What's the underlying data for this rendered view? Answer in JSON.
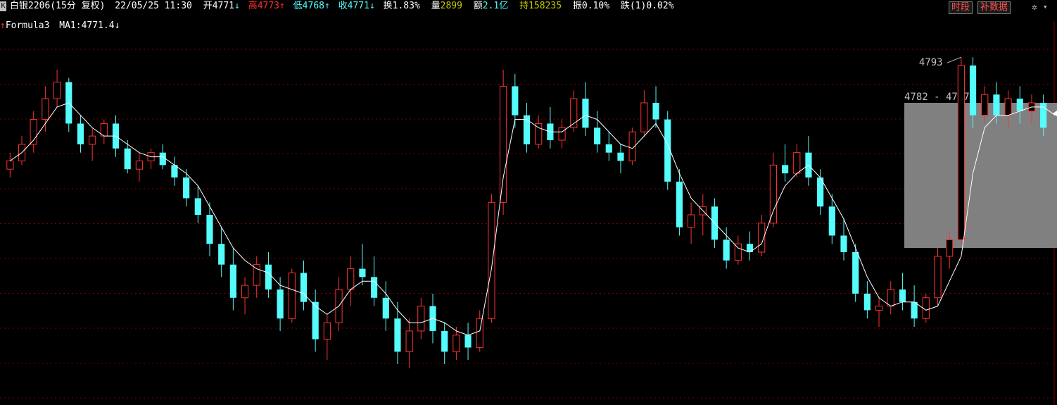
{
  "header": {
    "symbol": "白银2206(15分 复权)",
    "datetime": "22/05/25 11:30",
    "open_label": "开",
    "open": "4771",
    "open_arrow": "↓",
    "high_label": "高",
    "high": "4773",
    "high_arrow": "↑",
    "low_label": "低",
    "low": "4768",
    "low_arrow": "↑",
    "close_label": "收",
    "close": "4771",
    "close_arrow": "↓",
    "turnover_label": "换",
    "turnover": "1.83%",
    "volume_label": "量",
    "volume": "2899",
    "amount_label": "额",
    "amount": "2.1亿",
    "hold_label": "持",
    "hold": "158235",
    "amplitude_label": "振",
    "amplitude": "0.10%",
    "change_label": "跌",
    "change": "(1)0.02%",
    "btn_time": "时段",
    "btn_fill": "补数据",
    "corner": "K"
  },
  "indicator": {
    "name": "Formula3",
    "ma_label": "MA1:",
    "ma_value": "4771.4",
    "ma_arrow": "↓"
  },
  "colors": {
    "up": "#ff3232",
    "down": "#54fcfc",
    "ma": "#ffffff",
    "grid": "#800000",
    "zone": "#808080",
    "bg": "#000000"
  },
  "chart_data": {
    "type": "candlestick",
    "ylim": [
      4710,
      4800
    ],
    "annotations": {
      "high_label": "4793",
      "zone_label": "4782 - 4747",
      "zone_range": [
        4747,
        4782
      ]
    },
    "series": [
      {
        "name": "price",
        "candles_ohlc": [
          [
            4766,
            4770,
            4764,
            4768
          ],
          [
            4768,
            4774,
            4767,
            4772
          ],
          [
            4772,
            4780,
            4770,
            4778
          ],
          [
            4778,
            4786,
            4775,
            4783
          ],
          [
            4783,
            4790,
            4781,
            4787
          ],
          [
            4787,
            4788,
            4775,
            4777
          ],
          [
            4777,
            4779,
            4770,
            4772
          ],
          [
            4772,
            4776,
            4768,
            4774
          ],
          [
            4774,
            4778,
            4772,
            4777
          ],
          [
            4777,
            4779,
            4769,
            4771
          ],
          [
            4771,
            4773,
            4765,
            4766
          ],
          [
            4766,
            4770,
            4763,
            4768
          ],
          [
            4768,
            4771,
            4766,
            4770
          ],
          [
            4770,
            4772,
            4766,
            4767
          ],
          [
            4767,
            4769,
            4762,
            4764
          ],
          [
            4764,
            4766,
            4757,
            4759
          ],
          [
            4759,
            4762,
            4753,
            4755
          ],
          [
            4755,
            4758,
            4745,
            4748
          ],
          [
            4748,
            4752,
            4740,
            4743
          ],
          [
            4743,
            4747,
            4732,
            4735
          ],
          [
            4735,
            4740,
            4731,
            4738
          ],
          [
            4738,
            4745,
            4735,
            4743
          ],
          [
            4743,
            4746,
            4735,
            4737
          ],
          [
            4737,
            4740,
            4727,
            4730
          ],
          [
            4730,
            4742,
            4729,
            4741
          ],
          [
            4741,
            4744,
            4732,
            4734
          ],
          [
            4734,
            4737,
            4722,
            4725
          ],
          [
            4725,
            4731,
            4720,
            4729
          ],
          [
            4729,
            4740,
            4727,
            4737
          ],
          [
            4737,
            4745,
            4733,
            4742
          ],
          [
            4742,
            4748,
            4738,
            4740
          ],
          [
            4740,
            4745,
            4733,
            4735
          ],
          [
            4735,
            4739,
            4727,
            4730
          ],
          [
            4730,
            4734,
            4719,
            4722
          ],
          [
            4722,
            4730,
            4718,
            4727
          ],
          [
            4727,
            4735,
            4725,
            4733
          ],
          [
            4733,
            4736,
            4724,
            4727
          ],
          [
            4727,
            4729,
            4719,
            4722
          ],
          [
            4722,
            4728,
            4720,
            4726
          ],
          [
            4726,
            4729,
            4720,
            4723
          ],
          [
            4723,
            4732,
            4722,
            4730
          ],
          [
            4730,
            4760,
            4729,
            4758
          ],
          [
            4758,
            4790,
            4755,
            4786
          ],
          [
            4786,
            4789,
            4776,
            4779
          ],
          [
            4779,
            4782,
            4770,
            4772
          ],
          [
            4772,
            4779,
            4771,
            4777
          ],
          [
            4777,
            4781,
            4771,
            4773
          ],
          [
            4773,
            4778,
            4771,
            4776
          ],
          [
            4776,
            4785,
            4775,
            4783
          ],
          [
            4783,
            4787,
            4774,
            4776
          ],
          [
            4776,
            4780,
            4770,
            4772
          ],
          [
            4772,
            4775,
            4768,
            4770
          ],
          [
            4770,
            4772,
            4765,
            4768
          ],
          [
            4768,
            4776,
            4767,
            4775
          ],
          [
            4775,
            4785,
            4774,
            4782
          ],
          [
            4782,
            4786,
            4776,
            4778
          ],
          [
            4778,
            4780,
            4761,
            4763
          ],
          [
            4763,
            4766,
            4750,
            4752
          ],
          [
            4752,
            4758,
            4748,
            4755
          ],
          [
            4755,
            4760,
            4750,
            4757
          ],
          [
            4757,
            4759,
            4747,
            4749
          ],
          [
            4749,
            4752,
            4742,
            4744
          ],
          [
            4744,
            4750,
            4743,
            4748
          ],
          [
            4748,
            4751,
            4744,
            4746
          ],
          [
            4746,
            4755,
            4745,
            4753
          ],
          [
            4753,
            4770,
            4752,
            4767
          ],
          [
            4767,
            4772,
            4763,
            4765
          ],
          [
            4765,
            4772,
            4764,
            4770
          ],
          [
            4770,
            4774,
            4762,
            4764
          ],
          [
            4764,
            4766,
            4755,
            4757
          ],
          [
            4757,
            4760,
            4748,
            4750
          ],
          [
            4750,
            4754,
            4744,
            4746
          ],
          [
            4746,
            4748,
            4734,
            4736
          ],
          [
            4736,
            4739,
            4730,
            4732
          ],
          [
            4732,
            4735,
            4728,
            4733
          ],
          [
            4733,
            4739,
            4731,
            4737
          ],
          [
            4737,
            4741,
            4732,
            4734
          ],
          [
            4734,
            4738,
            4728,
            4730
          ],
          [
            4730,
            4736,
            4729,
            4735
          ],
          [
            4735,
            4747,
            4733,
            4745
          ],
          [
            4745,
            4751,
            4742,
            4749
          ],
          [
            4749,
            4793,
            4748,
            4791
          ],
          [
            4791,
            4793,
            4776,
            4779
          ],
          [
            4779,
            4786,
            4777,
            4784
          ],
          [
            4784,
            4787,
            4777,
            4779
          ],
          [
            4779,
            4785,
            4776,
            4783
          ],
          [
            4783,
            4786,
            4777,
            4780
          ],
          [
            4780,
            4784,
            4777,
            4782
          ],
          [
            4782,
            4784,
            4774,
            4776
          ]
        ]
      },
      {
        "name": "MA1",
        "values": [
          4768,
          4770,
          4773,
          4777,
          4781,
          4782,
          4779,
          4776,
          4774,
          4774,
          4772,
          4770,
          4769,
          4769,
          4767,
          4765,
          4762,
          4757,
          4752,
          4747,
          4744,
          4742,
          4741,
          4738,
          4737,
          4736,
          4733,
          4731,
          4733,
          4737,
          4739,
          4739,
          4736,
          4732,
          4729,
          4729,
          4730,
          4729,
          4727,
          4726,
          4727,
          4742,
          4764,
          4778,
          4778,
          4776,
          4775,
          4775,
          4777,
          4779,
          4778,
          4775,
          4772,
          4771,
          4774,
          4777,
          4772,
          4765,
          4759,
          4756,
          4753,
          4750,
          4747,
          4746,
          4748,
          4756,
          4762,
          4765,
          4767,
          4764,
          4759,
          4754,
          4747,
          4740,
          4735,
          4733,
          4734,
          4734,
          4732,
          4733,
          4739,
          4745,
          4765,
          4776,
          4779,
          4779,
          4780,
          4781,
          4781,
          4779
        ]
      }
    ]
  }
}
